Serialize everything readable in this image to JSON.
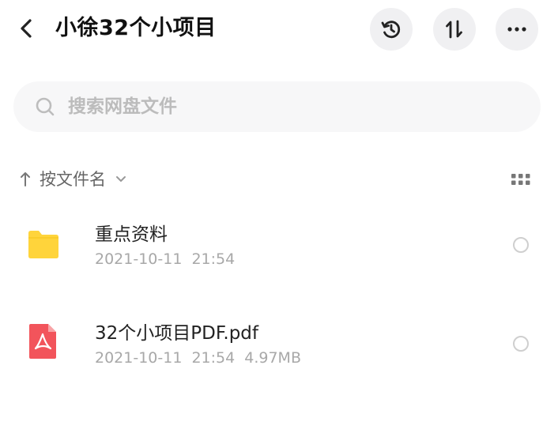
{
  "header": {
    "title": "小徐32个小项目",
    "buttons": [
      "history-icon",
      "sort-order-icon",
      "more-icon"
    ]
  },
  "search": {
    "placeholder": "搜索网盘文件",
    "value": ""
  },
  "sort": {
    "label": "按文件名",
    "direction": "ascending"
  },
  "files": [
    {
      "name": "重点资料",
      "meta": "2021-10-11  21:54",
      "type": "folder",
      "icon": "folder-icon",
      "color": "#ffd43b"
    },
    {
      "name": "32个小项目PDF.pdf",
      "meta": "2021-10-11  21:54  4.97MB",
      "type": "pdf",
      "icon": "pdf-icon",
      "color": "#f2545b"
    }
  ]
}
